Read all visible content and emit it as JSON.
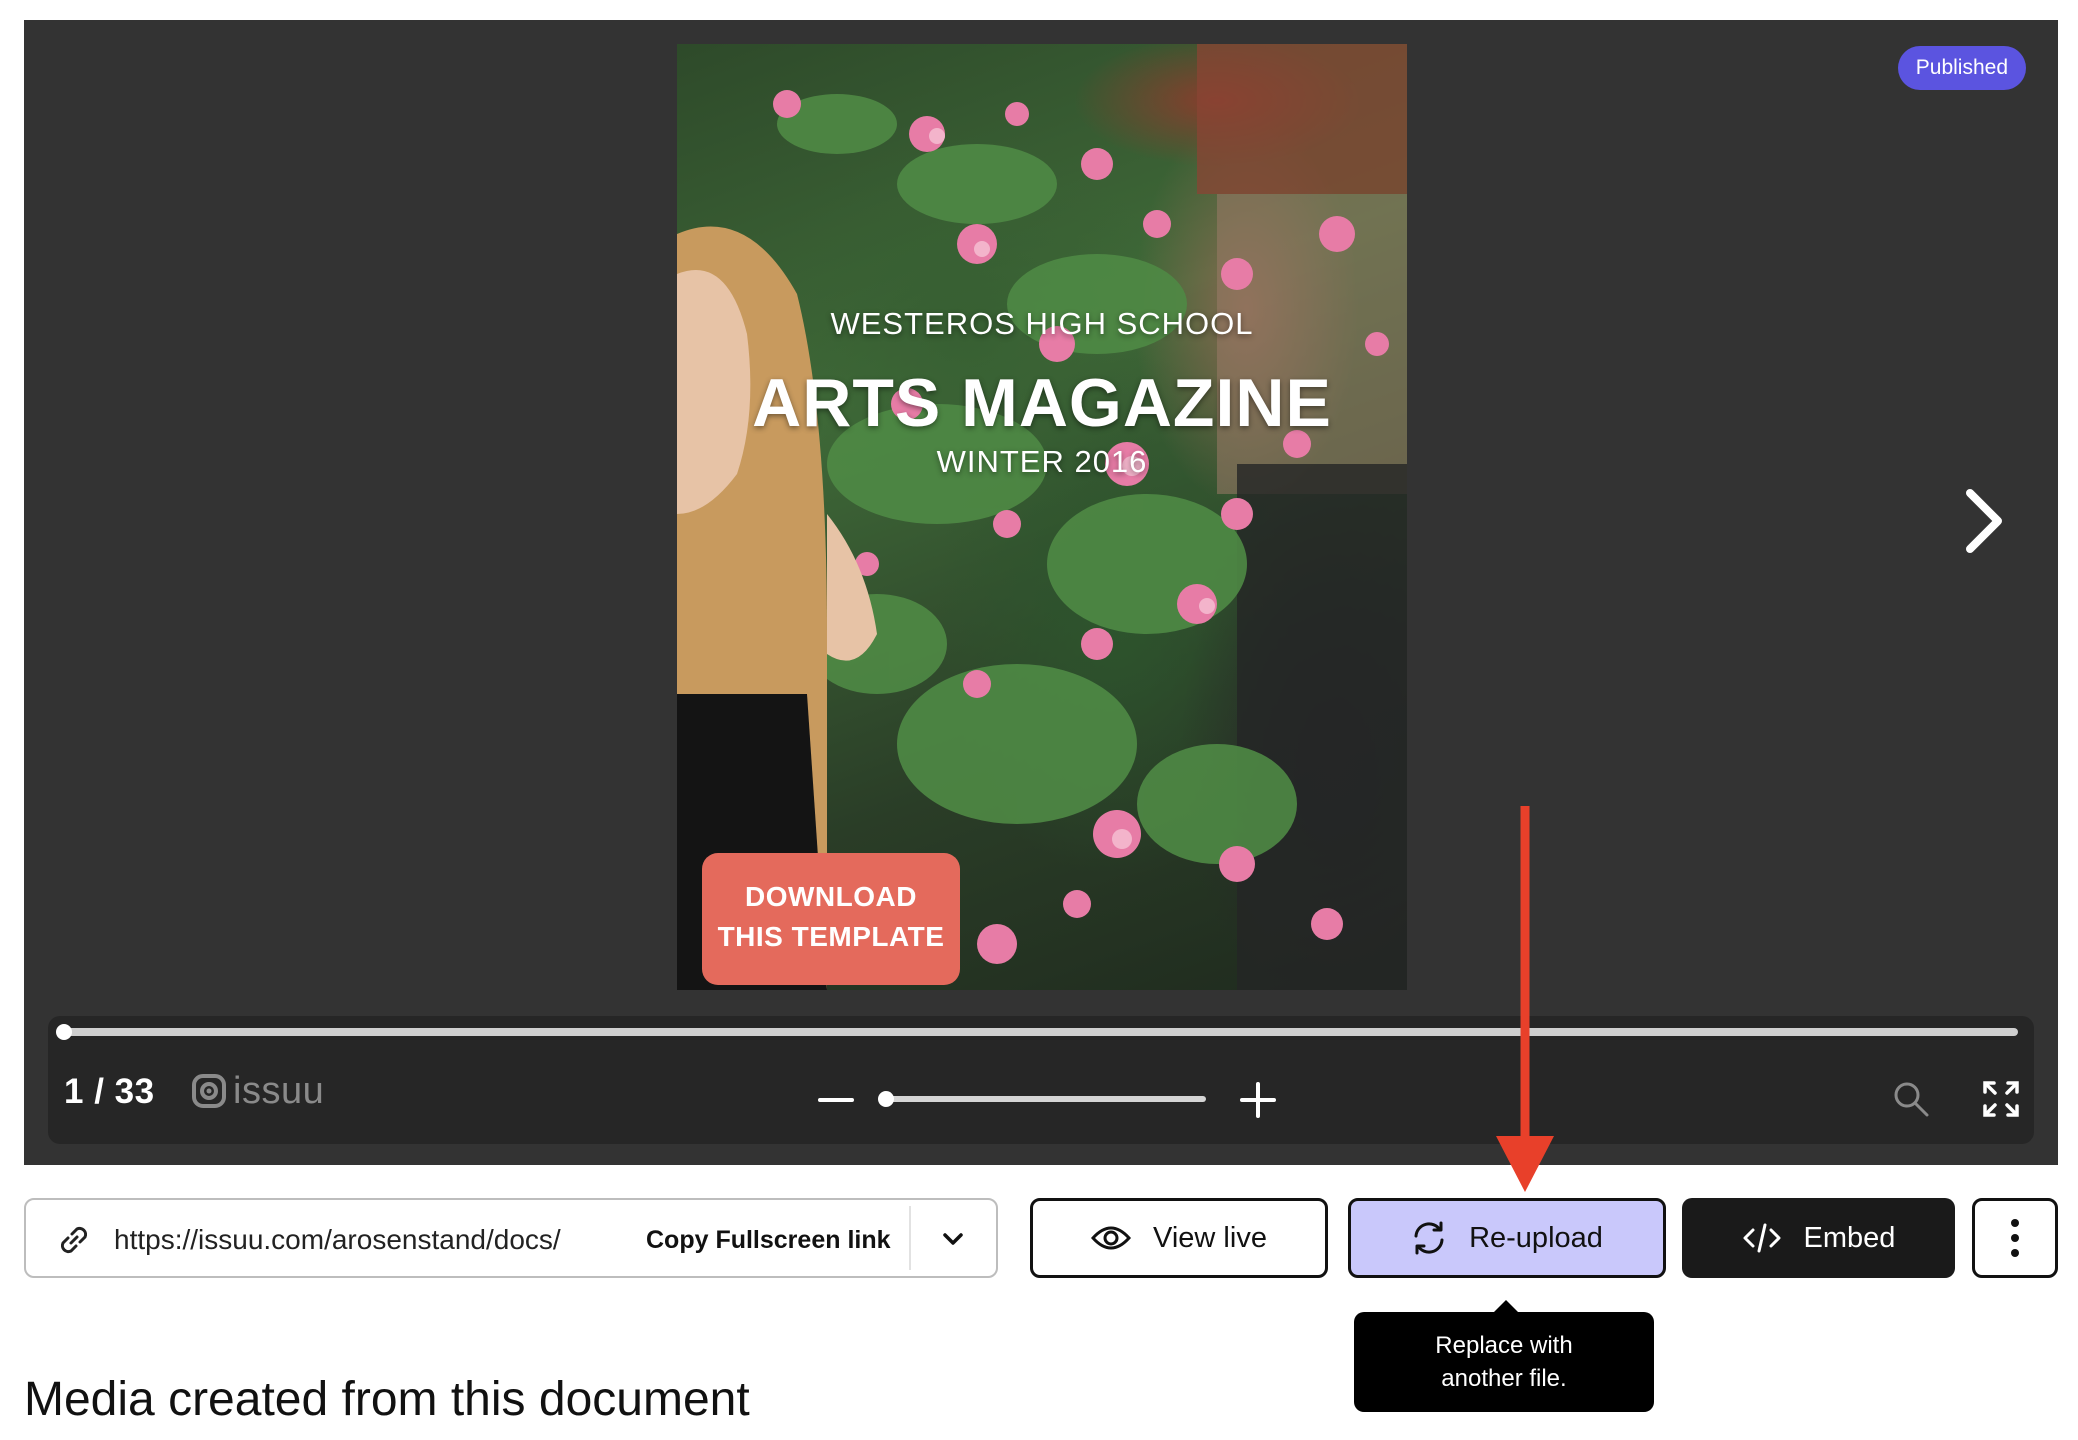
{
  "viewer": {
    "status_badge": "Published",
    "cover": {
      "kicker": "WESTEROS HIGH SCHOOL",
      "title": "ARTS MAGAZINE",
      "subtitle": "WINTER 2016",
      "cta_line1": "DOWNLOAD",
      "cta_line2": "THIS TEMPLATE"
    },
    "page_indicator": "1 / 33",
    "brand": "issuu",
    "progress": 0.0,
    "zoom_level": 0.0
  },
  "link_bar": {
    "url": "https://issuu.com/arosenstand/docs/",
    "copy_label": "Copy Fullscreen link"
  },
  "actions": {
    "view_live": "View live",
    "reupload": "Re-upload",
    "embed": "Embed"
  },
  "tooltip": {
    "line1": "Replace with",
    "line2": "another file."
  },
  "section": {
    "heading": "Media created from this document"
  },
  "colors": {
    "viewer_bg": "#333333",
    "badge": "#5b54e0",
    "cta": "#e46a5c",
    "reupload_bg": "#c9c8fb",
    "annotation_arrow": "#e8402a"
  },
  "icons": [
    "next-arrow-icon",
    "issuu-logo-icon",
    "minus-icon",
    "plus-icon",
    "search-icon",
    "fullscreen-icon",
    "link-icon",
    "chevron-down-icon",
    "eye-icon",
    "refresh-icon",
    "code-icon",
    "more-vertical-icon"
  ]
}
